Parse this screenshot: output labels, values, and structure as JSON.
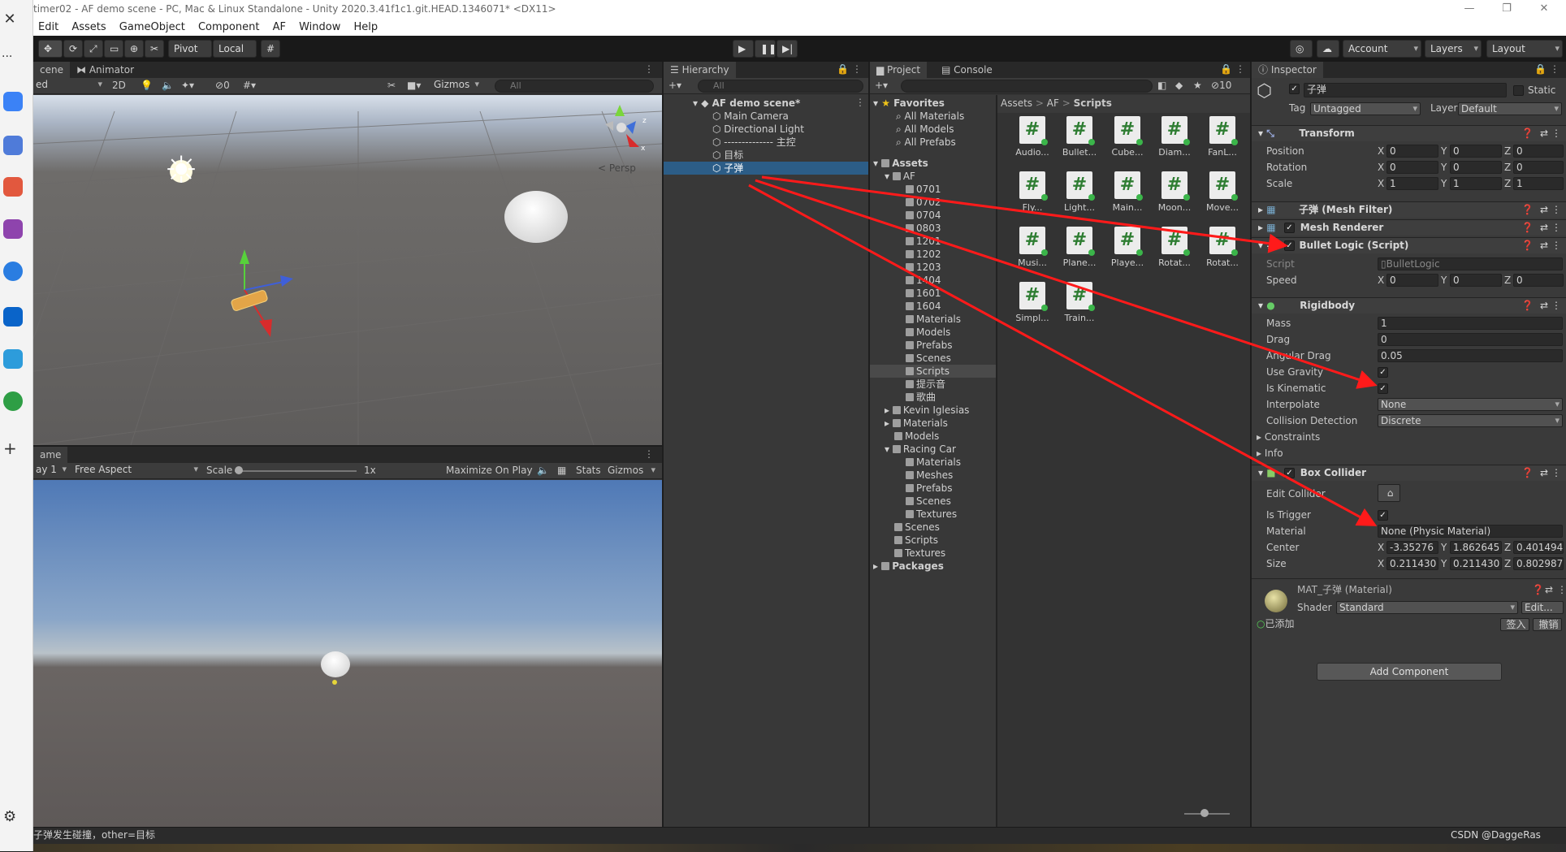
{
  "window": {
    "title": "timer02 - AF demo scene - PC, Mac & Linux Standalone - Unity 2020.3.41f1c1.git.HEAD.1346071* <DX11>"
  },
  "menu": [
    "Edit",
    "Assets",
    "GameObject",
    "Component",
    "AF",
    "Window",
    "Help"
  ],
  "toolbar": {
    "pivot": "Pivot",
    "local": "Local",
    "account": "Account",
    "layers": "Layers",
    "layout": "Layout"
  },
  "scene": {
    "tabs": [
      "cene",
      "Animator"
    ],
    "shading": "ed",
    "mode2d": "2D",
    "hidden_count": "0",
    "gizmos": "Gizmos",
    "search_placeholder": "All",
    "persp": "< Persp"
  },
  "game": {
    "tab": "ame",
    "display": "ay 1",
    "aspect": "Free Aspect",
    "scale_label": "Scale",
    "scale_value": "1x",
    "maximize": "Maximize On Play",
    "stats": "Stats",
    "gizmos": "Gizmos"
  },
  "hierarchy": {
    "tab": "Hierarchy",
    "search_placeholder": "All",
    "scene": "AF demo scene*",
    "items": [
      "Main Camera",
      "Directional Light",
      "-------------- 主控",
      "目标",
      "子弹"
    ],
    "selected": "子弹"
  },
  "project": {
    "tabs": [
      "Project",
      "Console"
    ],
    "hidden_count": "10",
    "favorites_label": "Favorites",
    "favorites": [
      "All Materials",
      "All Models",
      "All Prefabs"
    ],
    "assets_label": "Assets",
    "af_label": "AF",
    "af_children": [
      "0701",
      "0702",
      "0704",
      "0803",
      "1201",
      "1202",
      "1203",
      "1404",
      "1601",
      "1604",
      "Materials",
      "Models",
      "Prefabs",
      "Scenes",
      "Scripts",
      "提示音",
      "歌曲"
    ],
    "other_folders": [
      "Kevin Iglesias",
      "Materials",
      "Models",
      "Racing Car"
    ],
    "racing_children": [
      "Materials",
      "Meshes",
      "Prefabs",
      "Scenes",
      "Textures"
    ],
    "tail_folders": [
      "Scenes",
      "Scripts",
      "Textures"
    ],
    "packages": "Packages",
    "breadcrumb": [
      "Assets",
      "AF",
      "Scripts"
    ],
    "scripts": [
      "Audio...",
      "Bullet...",
      "Cube...",
      "Diam...",
      "FanL...",
      "Fly...",
      "Light...",
      "Main...",
      "Moon...",
      "Move...",
      "Musi...",
      "Plane...",
      "Playe...",
      "Rotat...",
      "Rotat...",
      "Simpl...",
      "Train..."
    ]
  },
  "inspector": {
    "tab": "Inspector",
    "object_name": "子弹",
    "static": "Static",
    "tag_label": "Tag",
    "tag": "Untagged",
    "layer_label": "Layer",
    "layer": "Default",
    "transform": {
      "title": "Transform",
      "position": {
        "label": "Position",
        "x": "0",
        "y": "0",
        "z": "0"
      },
      "rotation": {
        "label": "Rotation",
        "x": "0",
        "y": "0",
        "z": "0"
      },
      "scale": {
        "label": "Scale",
        "x": "1",
        "y": "1",
        "z": "1"
      }
    },
    "mesh_filter": "子弹 (Mesh Filter)",
    "mesh_renderer": "Mesh Renderer",
    "bullet_logic": {
      "title": "Bullet Logic (Script)",
      "script_label": "Script",
      "script_value": "BulletLogic",
      "speed_label": "Speed",
      "speed_x": "0",
      "speed_y": "0",
      "speed_z": "0"
    },
    "rigidbody": {
      "title": "Rigidbody",
      "mass_label": "Mass",
      "mass": "1",
      "drag_label": "Drag",
      "drag": "0",
      "angular_label": "Angular Drag",
      "angular": "0.05",
      "gravity_label": "Use Gravity",
      "kinematic_label": "Is Kinematic",
      "interpolate_label": "Interpolate",
      "interpolate": "None",
      "collision_label": "Collision Detection",
      "collision": "Discrete",
      "constraints": "Constraints",
      "info": "Info"
    },
    "box_collider": {
      "title": "Box Collider",
      "edit_label": "Edit Collider",
      "trigger_label": "Is Trigger",
      "material_label": "Material",
      "material": "None (Physic Material)",
      "center_label": "Center",
      "cx": "-3.35276",
      "cy": "1.862645",
      "cz": "0.401494",
      "size_label": "Size",
      "sx": "0.211430",
      "sy": "0.211430",
      "sz": "0.802987"
    },
    "material": {
      "title": "MAT_子弹 (Material)",
      "shader_label": "Shader",
      "shader": "Standard",
      "edit": "Edit...",
      "added": "已添加",
      "sign": "签入",
      "undo": "撤销"
    },
    "add_component": "Add Component"
  },
  "status": {
    "console_line": "子弹发生碰撞，other=目标",
    "watermark": "CSDN @DaggeRas"
  },
  "colors": {
    "selection": "#2c5d87",
    "annotation_arrow": "#ff1a1a"
  }
}
